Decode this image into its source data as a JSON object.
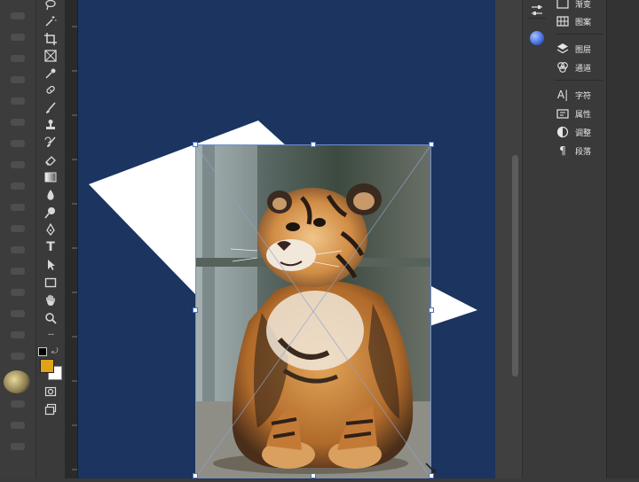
{
  "toolbar": {
    "tools": [
      "lasso-icon",
      "magic-wand-icon",
      "crop-icon",
      "frame-icon",
      "eyedropper-icon",
      "spot-healing-icon",
      "brush-icon",
      "clone-stamp-icon",
      "history-brush-icon",
      "eraser-icon",
      "gradient-icon",
      "blur-icon",
      "dodge-icon",
      "pen-icon",
      "type-icon",
      "path-selection-icon",
      "rectangle-icon",
      "hand-icon",
      "zoom-icon",
      "more-tools-icon"
    ],
    "type_glyph": "T",
    "more_glyph": "···",
    "foreground_color": "#e0a11c",
    "background_color": "#ffffff"
  },
  "canvas": {
    "background_color": "#1b3460",
    "paper_color": "#ffffff"
  },
  "panels": {
    "items": [
      {
        "label": "渐变",
        "icon": "gradient-panel-icon"
      },
      {
        "label": "图案",
        "icon": "pattern-panel-icon"
      },
      {
        "label": "图层",
        "icon": "layers-panel-icon"
      },
      {
        "label": "通道",
        "icon": "channels-panel-icon"
      },
      {
        "label": "字符",
        "icon": "character-panel-icon"
      },
      {
        "label": "属性",
        "icon": "properties-panel-icon"
      },
      {
        "label": "调整",
        "icon": "adjustments-panel-icon"
      },
      {
        "label": "段落",
        "icon": "paragraph-panel-icon"
      }
    ]
  }
}
